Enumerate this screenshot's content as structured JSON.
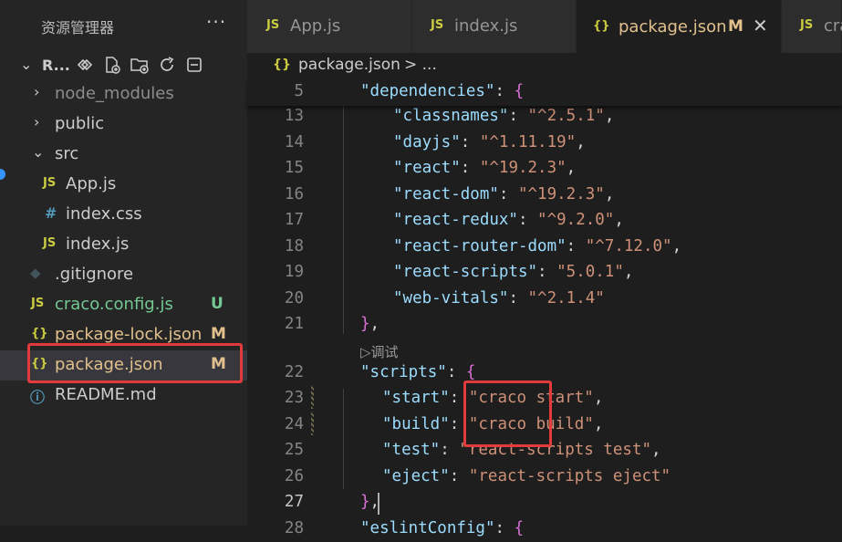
{
  "explorer": {
    "title": "资源管理器",
    "more": "···",
    "project": "R...",
    "items": [
      {
        "label": "node_modules",
        "icon": "chevron-right",
        "type": "folder",
        "status": ""
      },
      {
        "label": "public",
        "icon": "chevron-right",
        "type": "folder",
        "status": ""
      },
      {
        "label": "src",
        "icon": "chevron-down",
        "type": "folder",
        "status": ""
      },
      {
        "label": "App.js",
        "icon": "JS",
        "type": "js",
        "status": ""
      },
      {
        "label": "index.css",
        "icon": "#",
        "type": "css",
        "status": ""
      },
      {
        "label": "index.js",
        "icon": "JS",
        "type": "js",
        "status": ""
      },
      {
        "label": ".gitignore",
        "icon": "◆",
        "type": "git",
        "status": ""
      },
      {
        "label": "craco.config.js",
        "icon": "JS",
        "type": "js",
        "status": "U"
      },
      {
        "label": "package-lock.json",
        "icon": "{}",
        "type": "json",
        "status": "M"
      },
      {
        "label": "package.json",
        "icon": "{}",
        "type": "json",
        "status": "M"
      },
      {
        "label": "README.md",
        "icon": "ⓘ",
        "type": "info",
        "status": ""
      }
    ]
  },
  "tabs": [
    {
      "icon": "JS",
      "label": "App.js"
    },
    {
      "icon": "JS",
      "label": "index.js"
    },
    {
      "icon": "{}",
      "label": "package.json",
      "modified": "M",
      "close": "✕"
    },
    {
      "icon": "JS",
      "label": "cra"
    }
  ],
  "breadcrumb": {
    "icon": "{}",
    "file": "package.json",
    "rest": "> ..."
  },
  "codelens": "▷调试",
  "lines": {
    "l5": {
      "n": "5",
      "key": "\"dependencies\"",
      "punct": ": ",
      "brace": "{"
    },
    "l13": {
      "n": "13",
      "key": "\"classnames\"",
      "val": "\"^2.5.1\""
    },
    "l14": {
      "n": "14",
      "key": "\"dayjs\"",
      "val": "\"^1.11.19\""
    },
    "l15": {
      "n": "15",
      "key": "\"react\"",
      "val": "\"^19.2.3\""
    },
    "l16": {
      "n": "16",
      "key": "\"react-dom\"",
      "val": "\"^19.2.3\""
    },
    "l17": {
      "n": "17",
      "key": "\"react-redux\"",
      "val": "\"^9.2.0\""
    },
    "l18": {
      "n": "18",
      "key": "\"react-router-dom\"",
      "val": "\"^7.12.0\""
    },
    "l19": {
      "n": "19",
      "key": "\"react-scripts\"",
      "val": "\"5.0.1\""
    },
    "l20": {
      "n": "20",
      "key": "\"web-vitals\"",
      "val": "\"^2.1.4\""
    },
    "l21": {
      "n": "21",
      "close": "}",
      "comma": ","
    },
    "l22": {
      "n": "22",
      "key": "\"scripts\"",
      "punct": ": ",
      "brace": "{"
    },
    "l23": {
      "n": "23",
      "key": "\"start\"",
      "val": "\"craco start\""
    },
    "l24": {
      "n": "24",
      "key": "\"build\"",
      "val": "\"craco build\""
    },
    "l25": {
      "n": "25",
      "key": "\"test\"",
      "val": "\"react-scripts test\""
    },
    "l26": {
      "n": "26",
      "key": "\"eject\"",
      "val": "\"react-scripts eject\""
    },
    "l27": {
      "n": "27",
      "close": "}",
      "comma": ","
    },
    "l28": {
      "n": "28",
      "key": "\"eslintConfig\"",
      "punct": ": ",
      "brace": "{"
    }
  }
}
